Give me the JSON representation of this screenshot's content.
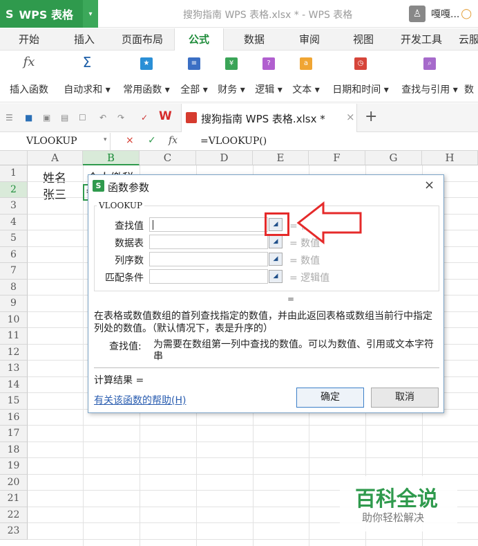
{
  "app": {
    "logo_glyph": "S",
    "name": "WPS 表格",
    "dropdown_glyph": "▾",
    "window_title": "搜狗指南 WPS 表格.xlsx * - WPS 表格",
    "user_name": "嘎嘎...",
    "accent": "#2f9a4d"
  },
  "menu": [
    "开始",
    "插入",
    "页面布局",
    "公式",
    "数据",
    "审阅",
    "视图",
    "开发工具",
    "云服"
  ],
  "menu_active": "公式",
  "ribbon": [
    {
      "label": "插入函数",
      "icon": "fx"
    },
    {
      "label": "自动求和 ▾",
      "icon": "Σ"
    },
    {
      "label": "常用函数 ▾",
      "icon": "★"
    },
    {
      "label": "全部 ▾",
      "icon": "≡"
    },
    {
      "label": "财务 ▾",
      "icon": "¥"
    },
    {
      "label": "逻辑 ▾",
      "icon": "?"
    },
    {
      "label": "文本 ▾",
      "icon": "a"
    },
    {
      "label": "日期和时间 ▾",
      "icon": "◷"
    },
    {
      "label": "查找与引用 ▾",
      "icon": "⌕"
    },
    {
      "label": "数",
      "icon": ""
    }
  ],
  "doc_tab": {
    "title": "搜狗指南 WPS 表格.xlsx *",
    "close": "×",
    "new_tab": "+"
  },
  "formula_bar": {
    "name_box": "VLOOKUP",
    "name_dropdown": "▾",
    "cancel": "×",
    "confirm": "✓",
    "fx": "fx",
    "content": "=VLOOKUP()"
  },
  "columns": [
    "A",
    "B",
    "C",
    "D",
    "E",
    "F",
    "G",
    "H"
  ],
  "rows": [
    "1",
    "2",
    "3",
    "4",
    "5",
    "6",
    "7",
    "8",
    "9",
    "10",
    "11",
    "12",
    "13",
    "14",
    "15",
    "16",
    "17",
    "18",
    "19",
    "20",
    "21",
    "22",
    "23"
  ],
  "cells": {
    "A1": "姓名",
    "B1": "个人缴税",
    "A2": "张三",
    "B2": "="
  },
  "dialog": {
    "title": "函数参数",
    "close": "×",
    "function_name": "VLOOKUP",
    "params": [
      {
        "label": "查找值",
        "type": "= 任意"
      },
      {
        "label": "数据表",
        "type": "= 数值"
      },
      {
        "label": "列序数",
        "type": "= 数值"
      },
      {
        "label": "匹配条件",
        "type": "= 逻辑值"
      }
    ],
    "equals": "=",
    "description": "在表格或数值数组的首列查找指定的数值，并由此返回表格或数组当前行中指定列处的数值。（默认情况下，表是升序的）",
    "param_desc_label": "查找值:",
    "param_desc_text": "为需要在数组第一列中查找的数值。可以为数值、引用或文本字符串",
    "result_label": "计算结果 =",
    "help_link": "有关该函数的帮助(H)",
    "ok": "确定",
    "cancel": "取消"
  },
  "watermark": {
    "title": "百科全说",
    "subtitle": "助你轻松解决"
  }
}
